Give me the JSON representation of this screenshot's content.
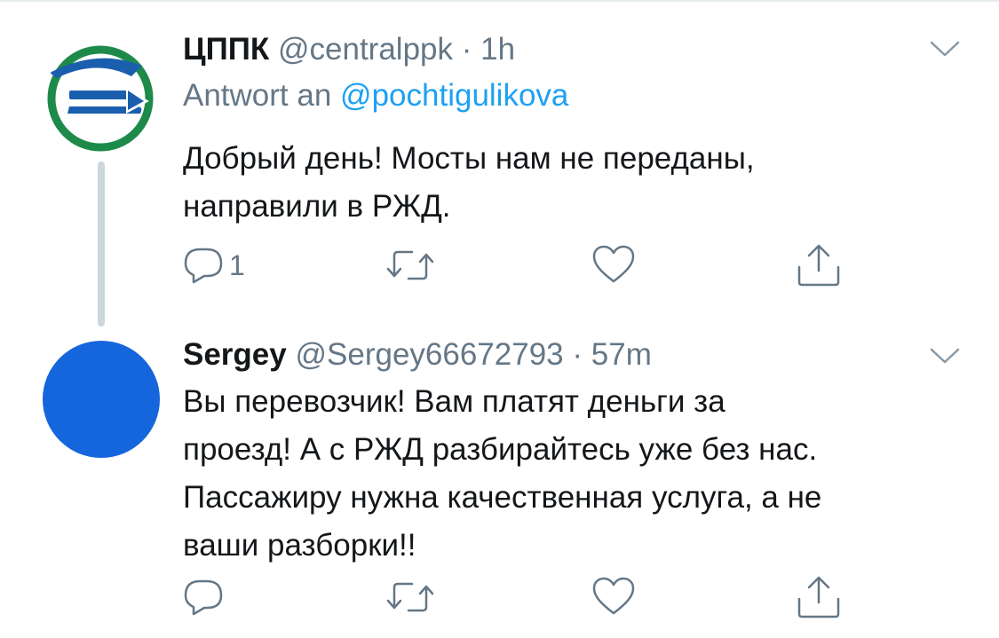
{
  "tweets": [
    {
      "name": "ЦППК",
      "handle": "@centralppk",
      "time": "1h",
      "reply_label": "Antwort an",
      "reply_to": "@pochtigulikova",
      "text_lines": [
        "Добрый день! Мосты нам не переданы,",
        "направили в РЖД."
      ],
      "actions": {
        "reply_count": "1"
      }
    },
    {
      "name": "Sergey",
      "handle": "@Sergey66672793",
      "time": "57m",
      "text_lines": [
        "Вы перевозчик! Вам платят деньги за",
        "проезд! А с РЖД разбирайтесь уже без нас.",
        "Пассажиру нужна качественная услуга, а не",
        "ваши разборки!!"
      ]
    }
  ],
  "separator": "·",
  "colors": {
    "accent": "#1da1f2",
    "secondary_text": "#657786",
    "thread_line": "#ccd6dd",
    "sergey_avatar": "#1565dc",
    "centralppk_logo_green": "#1e8a4a",
    "centralppk_logo_blue": "#1a5fae"
  },
  "icons": [
    "chevron-down-icon",
    "reply-icon",
    "retweet-icon",
    "like-icon",
    "share-icon"
  ]
}
